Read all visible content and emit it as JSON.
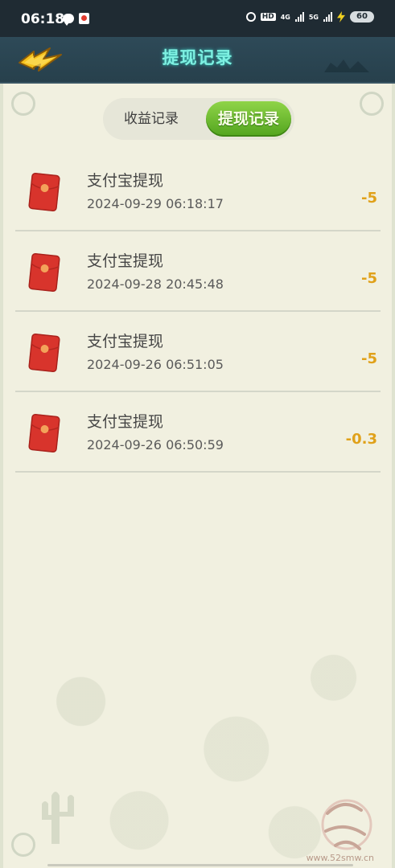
{
  "status_bar": {
    "time": "06:18",
    "network_a": "4G",
    "network_b": "5G",
    "hd_label": "HD",
    "battery": "60"
  },
  "header": {
    "title": "提现记录",
    "back_icon": "lightning-arrow-icon"
  },
  "tabs": [
    {
      "label": "收益记录",
      "active": false
    },
    {
      "label": "提现记录",
      "active": true
    }
  ],
  "records": [
    {
      "title": "支付宝提现",
      "time": "2024-09-29 06:18:17",
      "amount": "-5"
    },
    {
      "title": "支付宝提现",
      "time": "2024-09-28 20:45:48",
      "amount": "-5"
    },
    {
      "title": "支付宝提现",
      "time": "2024-09-26 06:51:05",
      "amount": "-5"
    },
    {
      "title": "支付宝提现",
      "time": "2024-09-26 06:50:59",
      "amount": "-0.3"
    }
  ],
  "watermark": {
    "url": "www.52smw.cn"
  },
  "colors": {
    "accent_green": "#5aa823",
    "amount_gold": "#e0a11a",
    "title_cyan": "#7ef1e2",
    "envelope_red": "#d8342c"
  }
}
